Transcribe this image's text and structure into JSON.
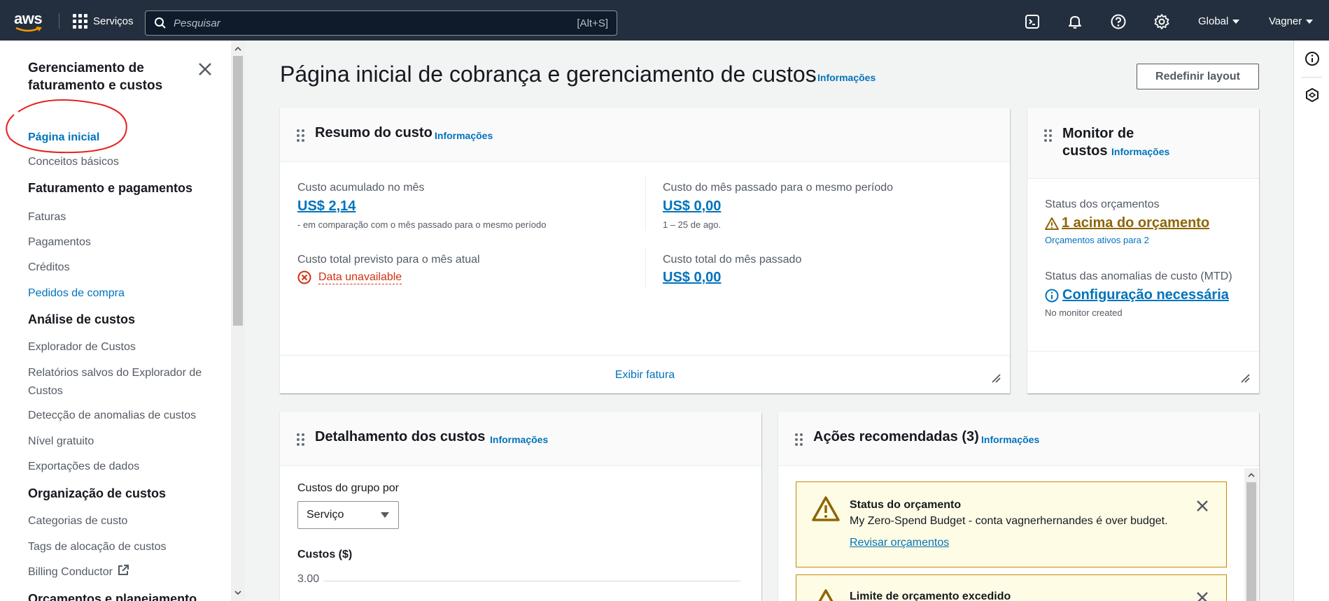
{
  "topnav": {
    "logo": "aws",
    "services_label": "Serviços",
    "search_placeholder": "Pesquisar",
    "search_shortcut": "[Alt+S]",
    "region_label": "Global",
    "user_label": "Vagner",
    "icons": [
      "cloudshell-icon",
      "bell-icon",
      "help-icon",
      "gear-icon"
    ]
  },
  "sidebar": {
    "title": "Gerenciamento de faturamento e custos",
    "items": [
      {
        "label": "Página inicial",
        "state": "active"
      },
      {
        "label": "Conceitos básicos"
      },
      {
        "section": "Faturamento e pagamentos"
      },
      {
        "label": "Faturas"
      },
      {
        "label": "Pagamentos"
      },
      {
        "label": "Créditos"
      },
      {
        "label": "Pedidos de compra",
        "state": "link"
      },
      {
        "section": "Análise de custos"
      },
      {
        "label": "Explorador de Custos"
      },
      {
        "label": "Relatórios salvos do Explorador de Custos"
      },
      {
        "label": "Detecção de anomalias de custos"
      },
      {
        "label": "Nível gratuito"
      },
      {
        "label": "Exportações de dados"
      },
      {
        "section": "Organização de custos"
      },
      {
        "label": "Categorias de custo"
      },
      {
        "label": "Tags de alocação de custos"
      },
      {
        "label": "Billing Conductor"
      },
      {
        "section": "Orçamentos e planejamento"
      }
    ]
  },
  "main": {
    "title": "Página inicial de cobrança e gerenciamento de custos",
    "info": "Informações",
    "reset_layout": "Redefinir layout",
    "cost_summary": {
      "title": "Resumo do custo",
      "info": "Informações",
      "mtd_label": "Custo acumulado no mês",
      "mtd_value": "US$ 2,14",
      "mtd_note": "- em comparação com o mês passado para o mesmo período",
      "last_period_label": "Custo do mês passado para o mesmo período",
      "last_period_value": "US$ 0,00",
      "last_period_note": "1 – 25 de ago.",
      "forecast_label": "Custo total previsto para o mês atual",
      "forecast_value": "Data unavailable",
      "last_month_label": "Custo total do mês passado",
      "last_month_value": "US$ 0,00",
      "footer_link": "Exibir fatura"
    },
    "cost_monitor": {
      "title_line1": "Monitor de",
      "title_line2": "custos",
      "info": "Informações",
      "budget_status_label": "Status dos orçamentos",
      "budget_status_value": "1 acima do orçamento",
      "budget_active": "Orçamentos ativos para 2",
      "anomaly_label": "Status das anomalias de custo (MTD)",
      "anomaly_value": "Configuração necessária",
      "anomaly_note": "No monitor created"
    },
    "cost_breakdown": {
      "title": "Detalhamento dos custos",
      "info": "Informações",
      "group_by_label": "Custos do grupo por",
      "group_by_value": "Serviço",
      "chart_ylabel": "Custos ($)",
      "chart_first_tick": "3.00"
    },
    "recommended": {
      "title": "Ações recomendadas (3)",
      "info": "Informações",
      "alerts": [
        {
          "title": "Status do orçamento",
          "text": "My Zero-Spend Budget - conta vagnerhernandes é over budget.",
          "link": "Revisar orçamentos"
        },
        {
          "title": "Limite de orçamento excedido"
        }
      ]
    },
    "colors": {
      "link": "#0073bb",
      "warning": "#c48900",
      "error": "#d13212",
      "nav_bg": "#232f3e"
    }
  }
}
